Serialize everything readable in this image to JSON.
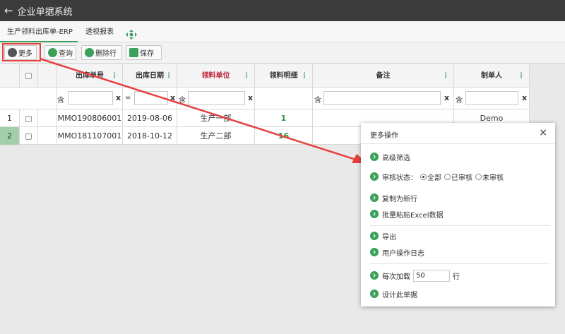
{
  "app": {
    "title": "企业单据系统"
  },
  "tabs": [
    {
      "label": "生产领料出库单-ERP"
    },
    {
      "label": "透视报表"
    }
  ],
  "toolbar": {
    "more": "更多",
    "query": "查询",
    "delete_row": "删除行",
    "save": "保存"
  },
  "table": {
    "columns": [
      {
        "label": "出库单号"
      },
      {
        "label": "出库日期"
      },
      {
        "label": "领料单位"
      },
      {
        "label": "领料明细"
      },
      {
        "label": "备注"
      },
      {
        "label": "制单人"
      }
    ],
    "filters": {
      "contains": "含",
      "equals": "=",
      "clear": "x"
    },
    "rows": [
      {
        "index": "1",
        "order_no": "MMO190806001",
        "date": "2019-08-06",
        "dept": "生产一部",
        "detail": "1",
        "remark": "",
        "maker": "Demo"
      },
      {
        "index": "2",
        "order_no": "MMO181107001",
        "date": "2018-10-12",
        "dept": "生产二部",
        "detail": "16",
        "remark": "",
        "maker": ""
      }
    ]
  },
  "modal": {
    "title": "更多操作",
    "close": "×",
    "advanced_filter": "高级筛选",
    "audit_status_label": "审核状态：",
    "audit_options": [
      "全部",
      "已审核",
      "未审核"
    ],
    "audit_selected": "全部",
    "copy_new": "复制为新行",
    "batch_paste": "批量粘贴Excel数据",
    "export": "导出",
    "user_log": "用户操作日志",
    "per_load_label": "每次加载",
    "per_load_value": "50",
    "per_load_unit": "行",
    "design": "设计此单据"
  },
  "colors": {
    "accent_green": "#3aa05a",
    "highlight_red": "#e64040",
    "titlebar": "#3b3b3b"
  },
  "icons": {
    "back": "arrow-left-icon",
    "move": "move-icon"
  }
}
